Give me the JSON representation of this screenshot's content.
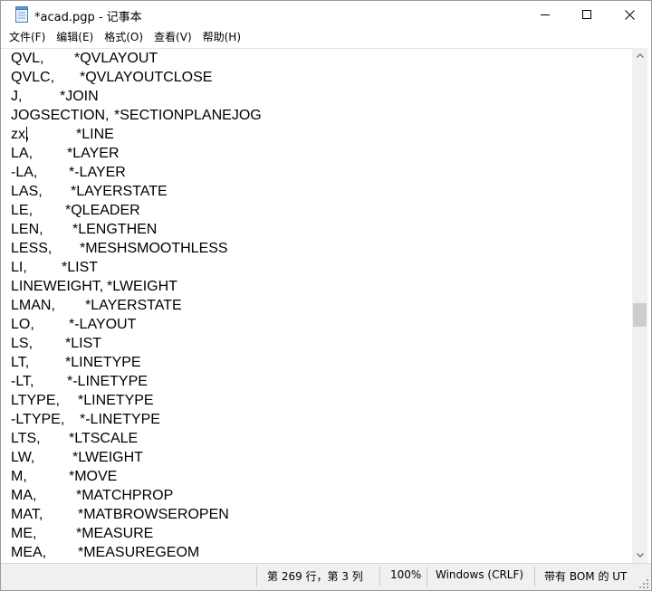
{
  "window": {
    "title": "*acad.pgp - 记事本"
  },
  "menu": [
    {
      "label": "文件(F)"
    },
    {
      "label": "编辑(E)"
    },
    {
      "label": "格式(O)"
    },
    {
      "label": "查看(V)"
    },
    {
      "label": "帮助(H)"
    }
  ],
  "editor": {
    "lines": [
      {
        "cmd": "QVL,",
        "target": "*QVLAYOUT",
        "indent": 70
      },
      {
        "cmd": "QVLC,",
        "target": "*QVLAYOUTCLOSE",
        "indent": 76
      },
      {
        "cmd": "J,",
        "target": "*JOIN",
        "indent": 54
      },
      {
        "cmd": "JOGSECTION,",
        "target": "*SECTIONPLANEJOG",
        "indent": 114
      },
      {
        "cmd": "zx,",
        "target": "*LINE",
        "indent": 72
      },
      {
        "cmd": "LA,",
        "target": "*LAYER",
        "indent": 62
      },
      {
        "cmd": "-LA,",
        "target": "*-LAYER",
        "indent": 64
      },
      {
        "cmd": "LAS,",
        "target": "*LAYERSTATE",
        "indent": 66
      },
      {
        "cmd": "LE,",
        "target": "*QLEADER",
        "indent": 60
      },
      {
        "cmd": "LEN,",
        "target": "*LENGTHEN",
        "indent": 68
      },
      {
        "cmd": "LESS,",
        "target": "*MESHSMOOTHLESS",
        "indent": 76
      },
      {
        "cmd": "LI,",
        "target": "*LIST",
        "indent": 56
      },
      {
        "cmd": "LINEWEIGHT,",
        "target": "*LWEIGHT",
        "indent": 106
      },
      {
        "cmd": "LMAN,",
        "target": "*LAYERSTATE",
        "indent": 82
      },
      {
        "cmd": "LO,",
        "target": "*-LAYOUT",
        "indent": 64
      },
      {
        "cmd": "LS,",
        "target": "*LIST",
        "indent": 60
      },
      {
        "cmd": "LT,",
        "target": "*LINETYPE",
        "indent": 60
      },
      {
        "cmd": "-LT,",
        "target": "*-LINETYPE",
        "indent": 62
      },
      {
        "cmd": "LTYPE,",
        "target": "*LINETYPE",
        "indent": 74
      },
      {
        "cmd": "-LTYPE,",
        "target": "*-LINETYPE",
        "indent": 76
      },
      {
        "cmd": "LTS,",
        "target": "*LTSCALE",
        "indent": 64
      },
      {
        "cmd": "LW,",
        "target": "*LWEIGHT",
        "indent": 68
      },
      {
        "cmd": "M,",
        "target": "*MOVE",
        "indent": 64
      },
      {
        "cmd": "MA,",
        "target": "*MATCHPROP",
        "indent": 72
      },
      {
        "cmd": "MAT,",
        "target": "*MATBROWSEROPEN",
        "indent": 74
      },
      {
        "cmd": "ME,",
        "target": "*MEASURE",
        "indent": 72
      },
      {
        "cmd": "MEA,",
        "target": "*MEASUREGEOM",
        "indent": 74
      }
    ]
  },
  "status": {
    "position": "第 269 行，第 3 列",
    "zoom": "100%",
    "line_ending": "Windows (CRLF)",
    "encoding": "带有 BOM 的 UT"
  }
}
